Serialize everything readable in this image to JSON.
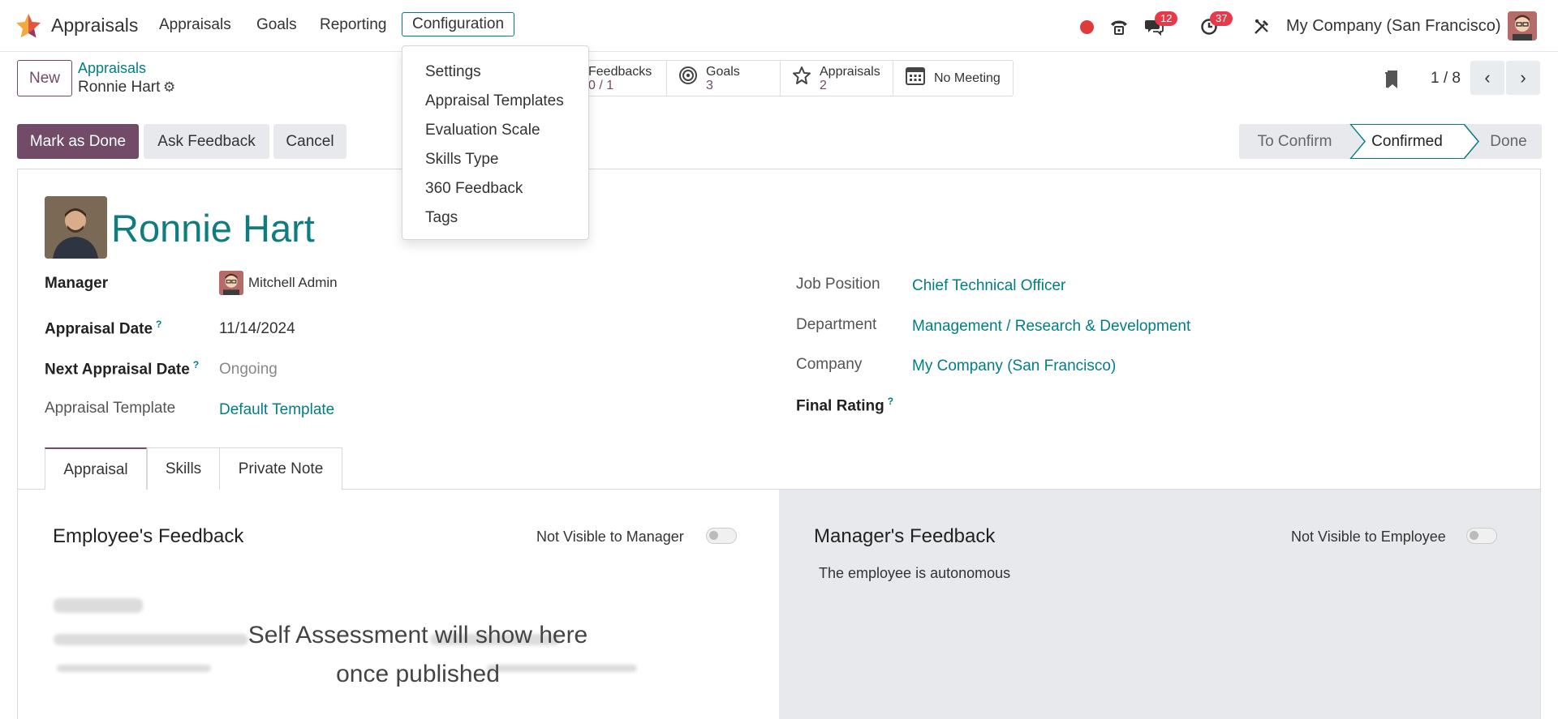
{
  "nav": {
    "app_name": "Appraisals",
    "menu": [
      "Appraisals",
      "Goals",
      "Reporting",
      "Configuration"
    ],
    "messages_badge": "12",
    "activities_badge": "37",
    "company": "My Company (San Francisco)"
  },
  "dropdown": {
    "items": [
      "Settings",
      "Appraisal Templates",
      "Evaluation Scale",
      "Skills Type",
      "360 Feedback",
      "Tags"
    ]
  },
  "control_panel": {
    "new_label": "New",
    "breadcrumb_parent": "Appraisals",
    "breadcrumb_current": "Ronnie Hart",
    "pager": "1 / 8"
  },
  "smart_buttons": {
    "feedbacks_label": "Feedbacks",
    "feedbacks_value": "0 / 1",
    "goals_label": "Goals",
    "goals_value": "3",
    "appraisals_label": "Appraisals",
    "appraisals_value": "2",
    "meeting_label": "No Meeting"
  },
  "actions": {
    "mark_done": "Mark as Done",
    "ask_feedback": "Ask Feedback",
    "cancel": "Cancel"
  },
  "status": {
    "stages": [
      "To Confirm",
      "Confirmed",
      "Done"
    ],
    "current": "Confirmed"
  },
  "form": {
    "employee_name": "Ronnie Hart",
    "manager_label": "Manager",
    "manager_value": "Mitchell Admin",
    "appraisal_date_label": "Appraisal Date",
    "appraisal_date_value": "11/14/2024",
    "next_date_label": "Next Appraisal Date",
    "next_date_value": "Ongoing",
    "template_label": "Appraisal Template",
    "template_value": "Default Template",
    "job_label": "Job Position",
    "job_value": "Chief Technical Officer",
    "department_label": "Department",
    "department_value": "Management / Research & Development",
    "company_label": "Company",
    "company_value": "My Company (San Francisco)",
    "final_rating_label": "Final Rating",
    "help_mark": "?"
  },
  "tabs": [
    "Appraisal",
    "Skills",
    "Private Note"
  ],
  "feedback": {
    "employee_title": "Employee's Feedback",
    "employee_toggle": "Not Visible to Manager",
    "employee_placeholder_1": "Self Assessment will show here",
    "employee_placeholder_2": "once published",
    "manager_title": "Manager's Feedback",
    "manager_toggle": "Not Visible to Employee",
    "manager_text": "The employee is autonomous"
  },
  "colors": {
    "brand": "#714b67",
    "link": "#017e84",
    "badge": "#e63a4a"
  }
}
